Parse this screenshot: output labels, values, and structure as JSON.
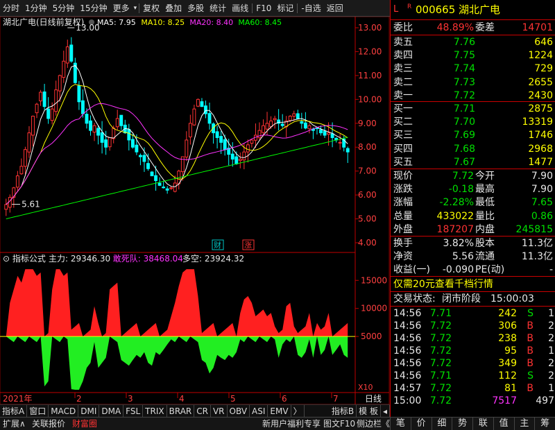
{
  "toolbar": {
    "items": [
      "分时",
      "1分钟",
      "5分钟",
      "15分钟",
      "更多",
      "复权",
      "叠加",
      "多股",
      "统计",
      "画线",
      "F10",
      "标记",
      "-自选",
      "返回"
    ],
    "more_arrow": "▾"
  },
  "chart": {
    "title": "湖北广电(日线前复权)",
    "ma": [
      {
        "label": "MA5: 7.95",
        "color": "#ffffff"
      },
      {
        "label": "MA10: 8.25",
        "color": "#ffff00"
      },
      {
        "label": "MA20: 8.40",
        "color": "#ff33ff"
      },
      {
        "label": "MA60: 8.45",
        "color": "#00ff00"
      }
    ],
    "high_label": "13.00",
    "low_label": "5.61",
    "markers": [
      {
        "text": "财",
        "color": "#00c8c8"
      },
      {
        "text": "涨",
        "color": "#ff3333"
      }
    ],
    "indicator_title": "指标公式",
    "indicator_values": [
      {
        "label": "主力: 29346.30",
        "color": "#e8e8e8"
      },
      {
        "label": "敢死队: 38468.04",
        "color": "#ff33ff"
      },
      {
        "label": "多空: 23924.32",
        "color": "#e8e8e8"
      }
    ],
    "x10": "X10",
    "year": "2021年",
    "day_label": "日线"
  },
  "chart_data": {
    "type": "candlestick",
    "xlabel": "",
    "ylabel": "",
    "ylim": [
      4,
      13
    ],
    "y_ticks": [
      "13.00",
      "12.00",
      "11.00",
      "10.00",
      "9.00",
      "8.00",
      "7.00",
      "6.00",
      "5.00",
      "4.00"
    ],
    "month_ticks": [
      "2",
      "3",
      "4",
      "5",
      "6",
      "7"
    ],
    "closes": [
      5.6,
      5.9,
      6.3,
      6.8,
      7.2,
      7.9,
      8.6,
      9.3,
      9.8,
      10.3,
      9.7,
      9.2,
      9.6,
      10.4,
      11.0,
      11.6,
      12.2,
      11.6,
      10.7,
      9.9,
      9.4,
      9.0,
      8.7,
      8.9,
      8.5,
      8.2,
      8.0,
      8.4,
      8.8,
      9.2,
      8.9,
      8.6,
      8.3,
      8.0,
      7.8,
      7.6,
      7.4,
      7.1,
      6.8,
      6.6,
      6.4,
      6.3,
      6.2,
      6.3,
      6.5,
      7.0,
      7.6,
      8.3,
      9.0,
      9.6,
      10.0,
      9.7,
      9.4,
      9.0,
      8.6,
      8.4,
      8.2,
      7.9,
      7.7,
      7.5,
      7.3,
      7.5,
      7.8,
      8.1,
      8.3,
      8.5,
      8.7,
      8.9,
      9.0,
      9.1,
      9.2,
      9.0,
      8.9,
      9.1,
      9.3,
      9.4,
      9.2,
      9.0,
      8.8,
      8.9,
      8.7,
      8.8,
      8.6,
      8.5,
      8.6,
      8.4,
      8.3,
      8.2,
      8.0,
      7.8
    ],
    "ma_last": {
      "MA5": 7.95,
      "MA10": 8.25,
      "MA20": 8.4,
      "MA60": 8.45
    },
    "indicator": {
      "ylim": [
        -5000,
        18000
      ],
      "y_ticks": [
        "15000",
        "10000",
        "5000"
      ],
      "series": [
        {
          "name": "主力",
          "last": 29346.3
        },
        {
          "name": "敢死队",
          "last": 38468.04
        },
        {
          "name": "多空",
          "last": 23924.32
        }
      ]
    }
  },
  "quote": {
    "flag_l": "L",
    "flag_r": "R",
    "code": "000665",
    "name": "湖北广电",
    "weibi_label": "委比",
    "weibi": "48.89%",
    "weicha_label": "委差",
    "weicha": "14701",
    "asks": [
      {
        "label": "卖五",
        "price": "7.76",
        "vol": "646"
      },
      {
        "label": "卖四",
        "price": "7.75",
        "vol": "1224"
      },
      {
        "label": "卖三",
        "price": "7.74",
        "vol": "729"
      },
      {
        "label": "卖二",
        "price": "7.73",
        "vol": "2655"
      },
      {
        "label": "卖一",
        "price": "7.72",
        "vol": "2430"
      }
    ],
    "bids": [
      {
        "label": "买一",
        "price": "7.71",
        "vol": "2875"
      },
      {
        "label": "买二",
        "price": "7.70",
        "vol": "13319"
      },
      {
        "label": "买三",
        "price": "7.69",
        "vol": "1746"
      },
      {
        "label": "买四",
        "price": "7.68",
        "vol": "2968"
      },
      {
        "label": "买五",
        "price": "7.67",
        "vol": "1477"
      }
    ],
    "stats": [
      {
        "l1": "现价",
        "v1": "7.72",
        "c1": "green",
        "l2": "今开",
        "v2": "7.90",
        "c2": "white"
      },
      {
        "l1": "涨跌",
        "v1": "-0.18",
        "c1": "green",
        "l2": "最高",
        "v2": "7.90",
        "c2": "white"
      },
      {
        "l1": "涨幅",
        "v1": "-2.28%",
        "c1": "green",
        "l2": "最低",
        "v2": "7.65",
        "c2": "green"
      },
      {
        "l1": "总量",
        "v1": "433022",
        "c1": "yellow",
        "l2": "量比",
        "v2": "0.86",
        "c2": "green"
      },
      {
        "l1": "外盘",
        "v1": "187207",
        "c1": "red",
        "l2": "内盘",
        "v2": "245815",
        "c2": "green"
      }
    ],
    "stats2": [
      {
        "l1": "换手",
        "v1": "3.82%",
        "l2": "股本",
        "v2": "11.3亿"
      },
      {
        "l1": "净资",
        "v1": "5.56",
        "l2": "流通",
        "v2": "11.3亿"
      },
      {
        "l1": "收益(一)",
        "v1": "-0.090",
        "l2": "PE(动)",
        "v2": "-"
      }
    ],
    "promo": "仅需20元查看千档行情",
    "trade_state_label": "交易状态:",
    "trade_state": "闭市阶段",
    "trade_time": "15:00:03",
    "ticks": [
      {
        "t": "14:56",
        "p": "7.71",
        "pc": "green",
        "v": "242",
        "bs": "S",
        "bc": "green",
        "n": "1"
      },
      {
        "t": "14:56",
        "p": "7.72",
        "pc": "green",
        "v": "306",
        "bs": "B",
        "bc": "red",
        "n": "2"
      },
      {
        "t": "14:56",
        "p": "7.72",
        "pc": "green",
        "v": "238",
        "bs": "B",
        "bc": "red",
        "n": "2"
      },
      {
        "t": "14:56",
        "p": "7.72",
        "pc": "green",
        "v": "95",
        "bs": "B",
        "bc": "red",
        "n": "1"
      },
      {
        "t": "14:56",
        "p": "7.72",
        "pc": "green",
        "v": "349",
        "bs": "B",
        "bc": "red",
        "n": "2"
      },
      {
        "t": "14:56",
        "p": "7.71",
        "pc": "green",
        "v": "112",
        "bs": "S",
        "bc": "green",
        "n": "2"
      },
      {
        "t": "14:57",
        "p": "7.72",
        "pc": "green",
        "v": "81",
        "bs": "B",
        "bc": "red",
        "n": "1"
      },
      {
        "t": "15:00",
        "p": "7.72",
        "pc": "green",
        "v": "7517",
        "bs": "",
        "bc": "white",
        "n": "497"
      }
    ]
  },
  "tabs": [
    "指标A",
    "窗口",
    "MACD",
    "DMI",
    "DMA",
    "FSL",
    "TRIX",
    "BRAR",
    "CR",
    "VR",
    "OBV",
    "ASI",
    "EMV",
    "〉",
    "指标B",
    "模 板",
    "◂"
  ],
  "status": {
    "expand": "扩展∧",
    "link": "关联报价",
    "fincap": "财富圈",
    "promo": "新用户福利专享",
    "f10": "图文F10",
    "sidebar": "侧边栏《"
  },
  "right_tabs": [
    "笔",
    "价",
    "细",
    "势",
    "联",
    "值",
    "主",
    "筹"
  ]
}
